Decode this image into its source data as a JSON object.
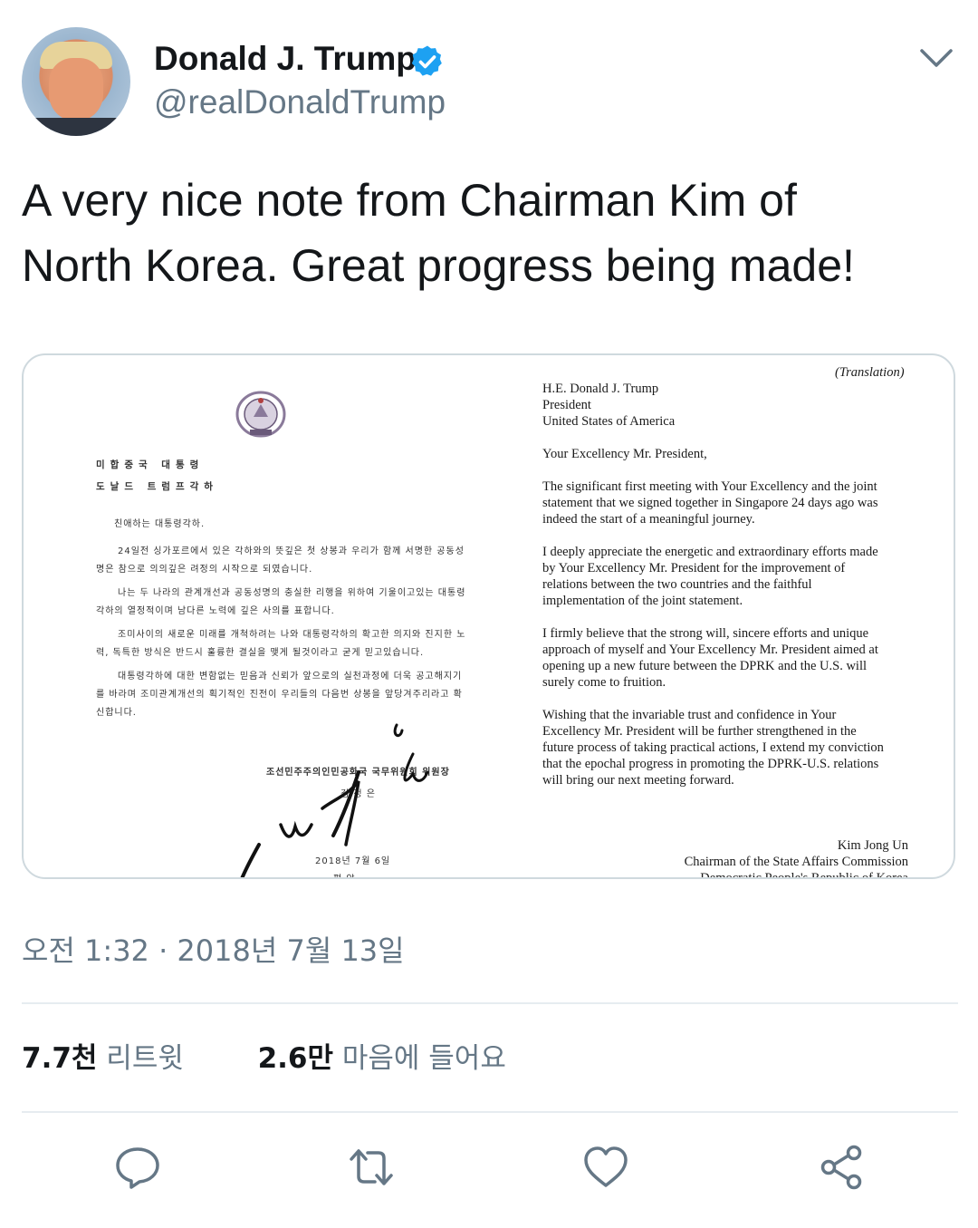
{
  "header": {
    "display_name": "Donald J. Trump",
    "handle": "@realDonaldTrump",
    "verified_icon": "verified-badge-icon",
    "menu_icon": "chevron-down-icon"
  },
  "tweet": {
    "text_line1": "A very nice note from Chairman Kim of",
    "text_line2": "North Korea. Great progress being made!"
  },
  "media": {
    "korean_letter": {
      "addr1": "미합중국 대통령",
      "addr2": "도날드 트럼프각하",
      "greeting": "친애하는 대통령각하.",
      "p1a": "24일전 싱가포르에서 있은 각하와의 뜻깊은 첫 상봉과 우리가 함께 서명한 공동성",
      "p1b": "명은 참으로 의의깊은 려정의 시작으로 되였습니다.",
      "p2a": "나는 두 나라의 관계개선과 공동성명의 충실한 리행을 위하여 기울이고있는 대통령",
      "p2b": "각하의 열정적이며 남다른 노력에 깊은 사의를 표합니다.",
      "p3a": "조미사이의 새로운 미래를 개척하려는 나와 대통령각하의 확고한 의지와 진지한 노",
      "p3b": "력, 독특한 방식은 반드시 훌륭한 결실을 맺게 될것이라고 굳게 믿고있습니다.",
      "p4a": "대통령각하에 대한 변함없는 믿음과 신뢰가 앞으로의 실천과정에 더욱 공고해지기",
      "p4b": "를 바라며 조미관계개선의 획기적인 진전이 우리들의 다음번 상봉을 앞당겨주리라고 확",
      "p4c": "신합니다.",
      "sender_title": "조선민주주의인민공화국 국무위원회 위원장",
      "sender_name": "김 정 은",
      "date": "2018년 7월 6일",
      "place": "평 양"
    },
    "english_letter": {
      "label": "(Translation)",
      "to1": "H.E. Donald J. Trump",
      "to2": "President",
      "to3": "United States of America",
      "salutation": "Your Excellency Mr. President,",
      "p1": [
        "The significant first meeting with Your Excellency and the joint",
        "statement that we signed together in Singapore 24 days ago was",
        "indeed the start of a meaningful journey."
      ],
      "p2": [
        "I deeply appreciate the energetic and extraordinary efforts made",
        "by Your Excellency Mr. President for the improvement of",
        "relations between the two countries and the faithful",
        "implementation of the joint statement."
      ],
      "p3": [
        "I firmly believe that the strong will, sincere efforts and unique",
        "approach of myself and Your Excellency Mr. President aimed at",
        "opening up a new future between the DPRK and the U.S. will",
        "surely come to fruition."
      ],
      "p4": [
        "Wishing that the invariable trust and confidence in Your",
        "Excellency Mr. President will be further strengthened in the",
        "future process of taking practical actions, I extend my conviction",
        "that the epochal progress in promoting the DPRK-U.S. relations",
        "will bring our next meeting forward."
      ],
      "signer": "Kim Jong Un",
      "signer_title": "Chairman of the State Affairs Commission",
      "signer_country": "Democratic People's Republic of Korea"
    }
  },
  "footer": {
    "timestamp": "오전 1:32 · 2018년 7월 13일",
    "retweets_count": "7.7천",
    "retweets_label": "리트윗",
    "likes_count": "2.6만",
    "likes_label": "마음에 들어요"
  },
  "actions": {
    "reply_icon": "reply-icon",
    "retweet_icon": "retweet-icon",
    "like_icon": "heart-icon",
    "share_icon": "share-icon"
  },
  "colors": {
    "text": "#14171a",
    "secondary": "#657786",
    "verified": "#1da1f2",
    "divider": "#e6ecf0"
  }
}
